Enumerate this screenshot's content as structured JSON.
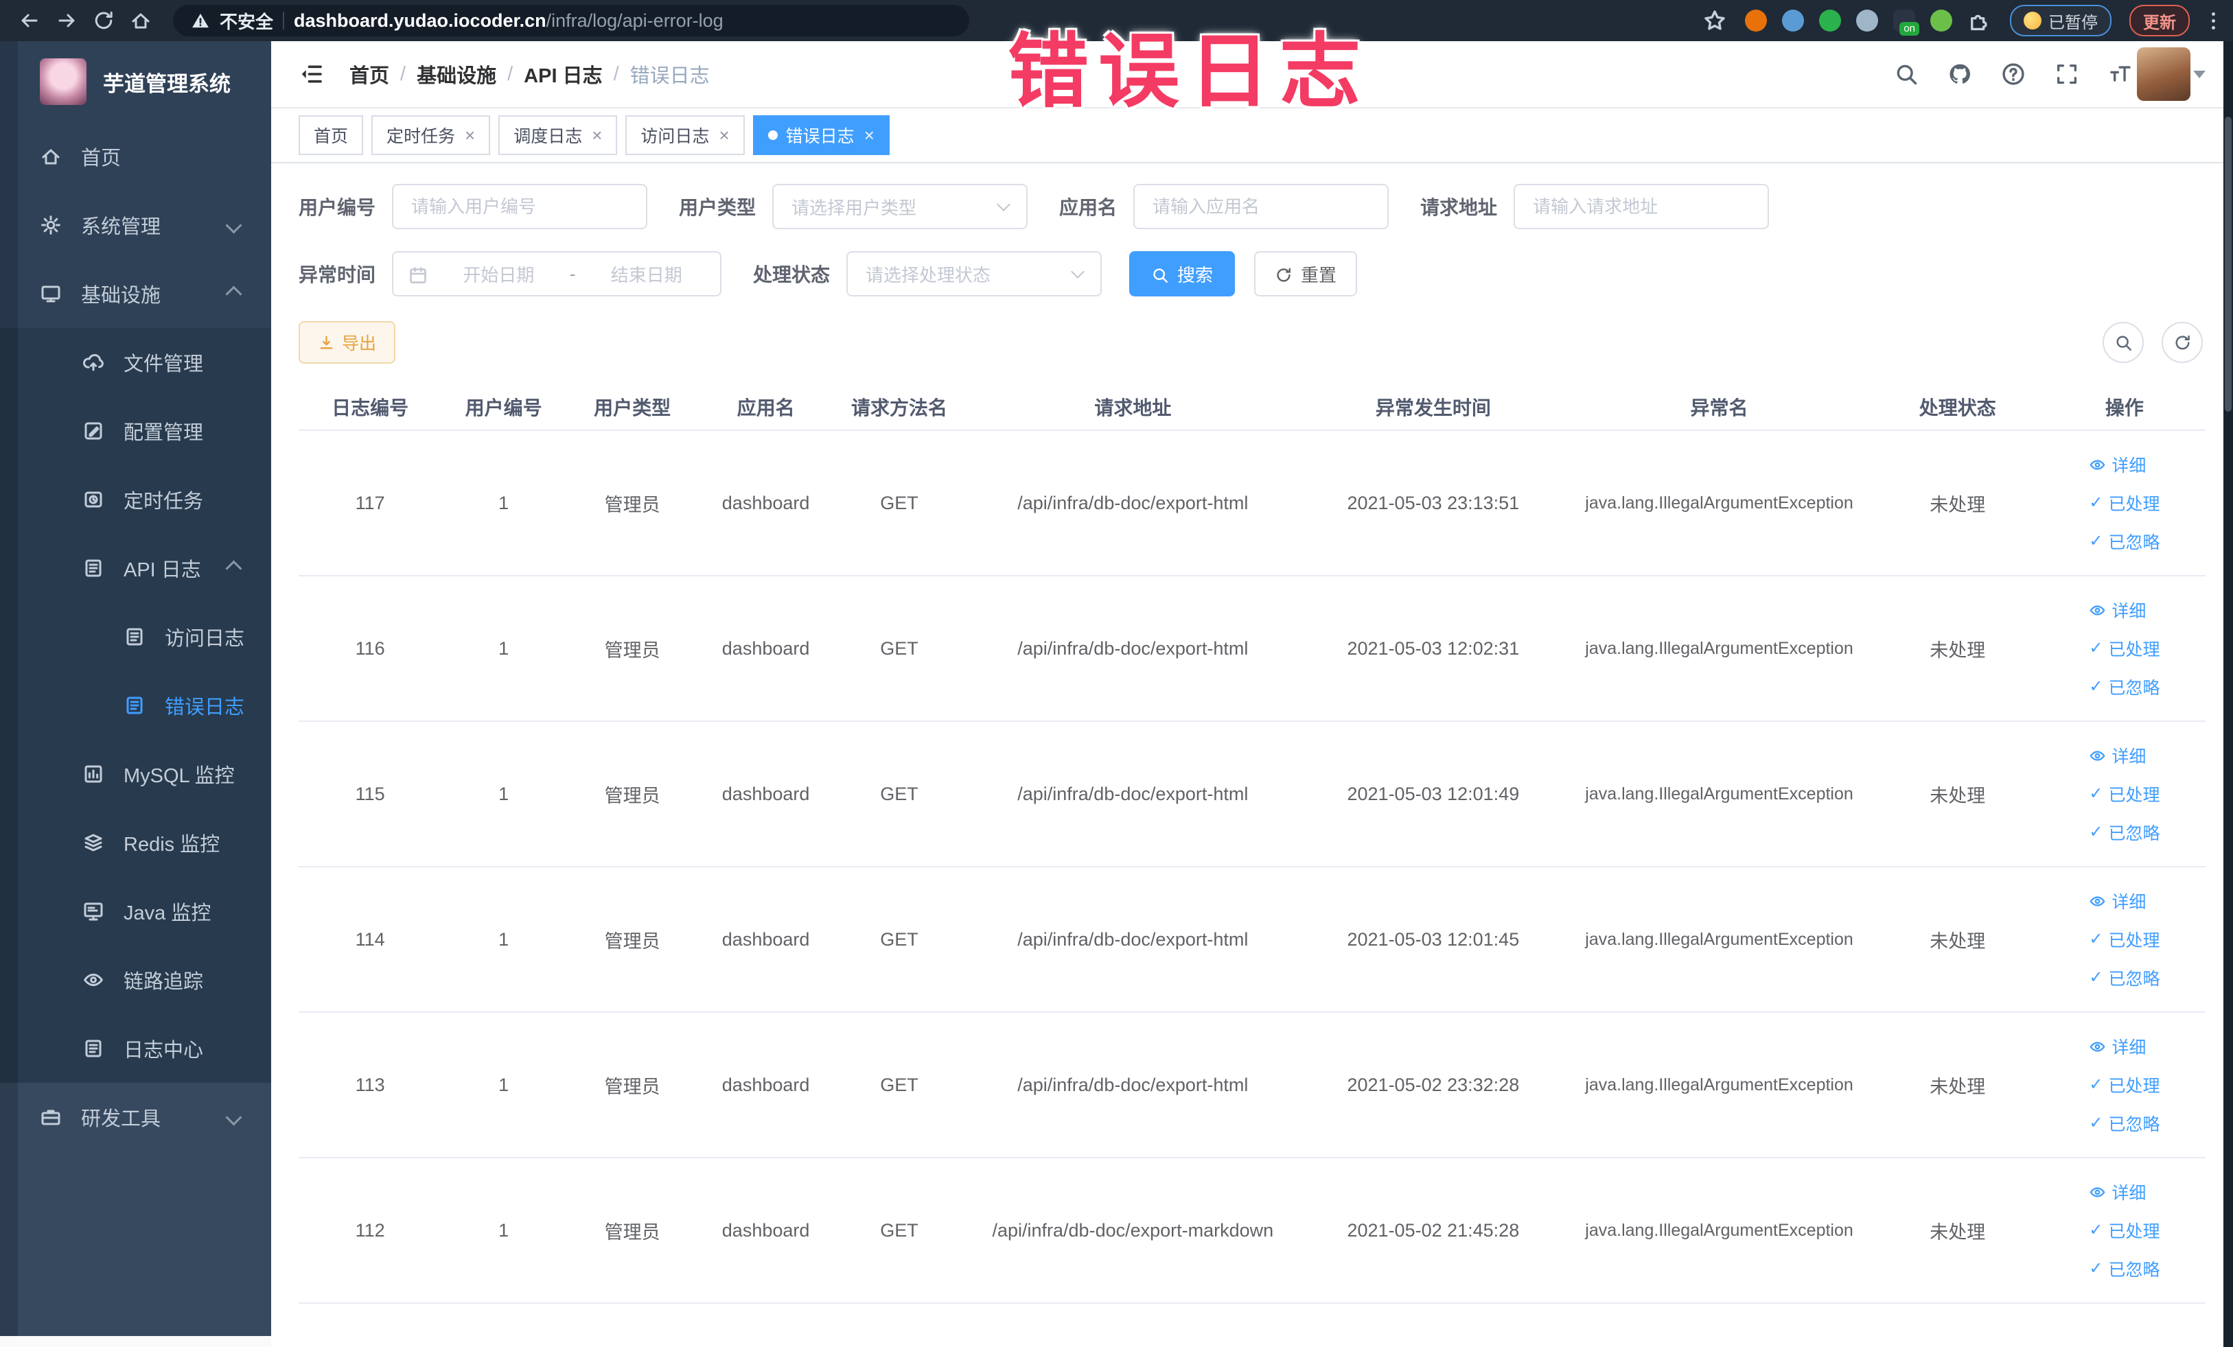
{
  "browser": {
    "security_label": "不安全",
    "url_domain": "dashboard.yudao.iocoder.cn",
    "url_path": "/infra/log/api-error-log",
    "nav_icons": [
      "arrow-left-icon",
      "arrow-right-icon",
      "reload-icon",
      "home-icon"
    ],
    "extensions": [
      {
        "name": "ext-orange-icon",
        "color": "#e8710a"
      },
      {
        "name": "ext-shield-icon",
        "color": "#5b9bd5"
      },
      {
        "name": "ext-green-icon",
        "color": "#2bb24c"
      },
      {
        "name": "ext-grid-icon",
        "color": "#9fb6c8"
      },
      {
        "name": "ext-on-toggle-icon",
        "color": "#23a63b",
        "label": "on"
      },
      {
        "name": "ext-leaf-icon",
        "color": "#6cc04a"
      },
      {
        "name": "puzzle-icon",
        "color": "#e8eaed"
      }
    ],
    "paused_badge": "已暂停",
    "update_button": "更新"
  },
  "annotation": {
    "text": "错误日志",
    "color": "#f43b63"
  },
  "sidebar": {
    "logo_title": "芋道管理系统",
    "items": [
      {
        "label": "首页",
        "icon": "home-icon",
        "level": 0
      },
      {
        "label": "系统管理",
        "icon": "gear-icon",
        "level": 0,
        "chevron": "down"
      },
      {
        "label": "基础设施",
        "icon": "monitor-icon",
        "level": 0,
        "chevron": "up"
      },
      {
        "label": "文件管理",
        "icon": "cloud-upload-icon",
        "level": 1
      },
      {
        "label": "配置管理",
        "icon": "edit-square-icon",
        "level": 1
      },
      {
        "label": "定时任务",
        "icon": "timer-icon",
        "level": 1
      },
      {
        "label": "API 日志",
        "icon": "document-icon",
        "level": 1,
        "chevron": "up"
      },
      {
        "label": "访问日志",
        "icon": "document-icon",
        "level": 2
      },
      {
        "label": "错误日志",
        "icon": "document-icon",
        "level": 2,
        "active": true
      },
      {
        "label": "MySQL 监控",
        "icon": "chart-icon",
        "level": 1
      },
      {
        "label": "Redis 监控",
        "icon": "stack-icon",
        "level": 1
      },
      {
        "label": "Java 监控",
        "icon": "screen-icon",
        "level": 1
      },
      {
        "label": "链路追踪",
        "icon": "eye-icon",
        "level": 1
      },
      {
        "label": "日志中心",
        "icon": "document-icon",
        "level": 1
      },
      {
        "label": "研发工具",
        "icon": "toolbox-icon",
        "level": 0,
        "chevron": "down",
        "section": "light"
      }
    ]
  },
  "breadcrumb": {
    "items": [
      "首页",
      "基础设施",
      "API 日志",
      "错误日志"
    ]
  },
  "header_icons": [
    "search-icon",
    "github-icon",
    "help-icon",
    "fullscreen-icon",
    "font-size-icon"
  ],
  "tabs": [
    {
      "label": "首页",
      "closable": false
    },
    {
      "label": "定时任务",
      "closable": true
    },
    {
      "label": "调度日志",
      "closable": true
    },
    {
      "label": "访问日志",
      "closable": true
    },
    {
      "label": "错误日志",
      "closable": true,
      "active": true
    }
  ],
  "filters": {
    "user_id": {
      "label": "用户编号",
      "placeholder": "请输入用户编号"
    },
    "user_type": {
      "label": "用户类型",
      "placeholder": "请选择用户类型"
    },
    "app_name": {
      "label": "应用名",
      "placeholder": "请输入应用名"
    },
    "request_url": {
      "label": "请求地址",
      "placeholder": "请输入请求地址"
    },
    "exception_time": {
      "label": "异常时间",
      "start_placeholder": "开始日期",
      "separator": "-",
      "end_placeholder": "结束日期"
    },
    "process_status": {
      "label": "处理状态",
      "placeholder": "请选择处理状态"
    },
    "search_button": "搜索",
    "reset_button": "重置"
  },
  "toolbar": {
    "export_button": "导出"
  },
  "table": {
    "columns": [
      "日志编号",
      "用户编号",
      "用户类型",
      "应用名",
      "请求方法名",
      "请求地址",
      "异常发生时间",
      "异常名",
      "处理状态",
      "操作"
    ],
    "actions": [
      "详细",
      "已处理",
      "已忽略"
    ],
    "rows": [
      {
        "id": "117",
        "user_id": "1",
        "user_type": "管理员",
        "app": "dashboard",
        "method": "GET",
        "url": "/api/infra/db-doc/export-html",
        "time": "2021-05-03 23:13:51",
        "exception": "java.lang.IllegalArgumentException",
        "status": "未处理"
      },
      {
        "id": "116",
        "user_id": "1",
        "user_type": "管理员",
        "app": "dashboard",
        "method": "GET",
        "url": "/api/infra/db-doc/export-html",
        "time": "2021-05-03 12:02:31",
        "exception": "java.lang.IllegalArgumentException",
        "status": "未处理"
      },
      {
        "id": "115",
        "user_id": "1",
        "user_type": "管理员",
        "app": "dashboard",
        "method": "GET",
        "url": "/api/infra/db-doc/export-html",
        "time": "2021-05-03 12:01:49",
        "exception": "java.lang.IllegalArgumentException",
        "status": "未处理"
      },
      {
        "id": "114",
        "user_id": "1",
        "user_type": "管理员",
        "app": "dashboard",
        "method": "GET",
        "url": "/api/infra/db-doc/export-html",
        "time": "2021-05-03 12:01:45",
        "exception": "java.lang.IllegalArgumentException",
        "status": "未处理"
      },
      {
        "id": "113",
        "user_id": "1",
        "user_type": "管理员",
        "app": "dashboard",
        "method": "GET",
        "url": "/api/infra/db-doc/export-html",
        "time": "2021-05-02 23:32:28",
        "exception": "java.lang.IllegalArgumentException",
        "status": "未处理"
      },
      {
        "id": "112",
        "user_id": "1",
        "user_type": "管理员",
        "app": "dashboard",
        "method": "GET",
        "url": "/api/infra/db-doc/export-markdown",
        "time": "2021-05-02 21:45:28",
        "exception": "java.lang.IllegalArgumentException",
        "status": "未处理"
      }
    ]
  },
  "colors": {
    "accent": "#409eff",
    "sidebar_bg": "#2f4156",
    "submenu_bg": "#283a4d",
    "chrome_bg": "#1f2a36",
    "warning": "#e6a23c",
    "annotation_pink": "#f43b63"
  }
}
